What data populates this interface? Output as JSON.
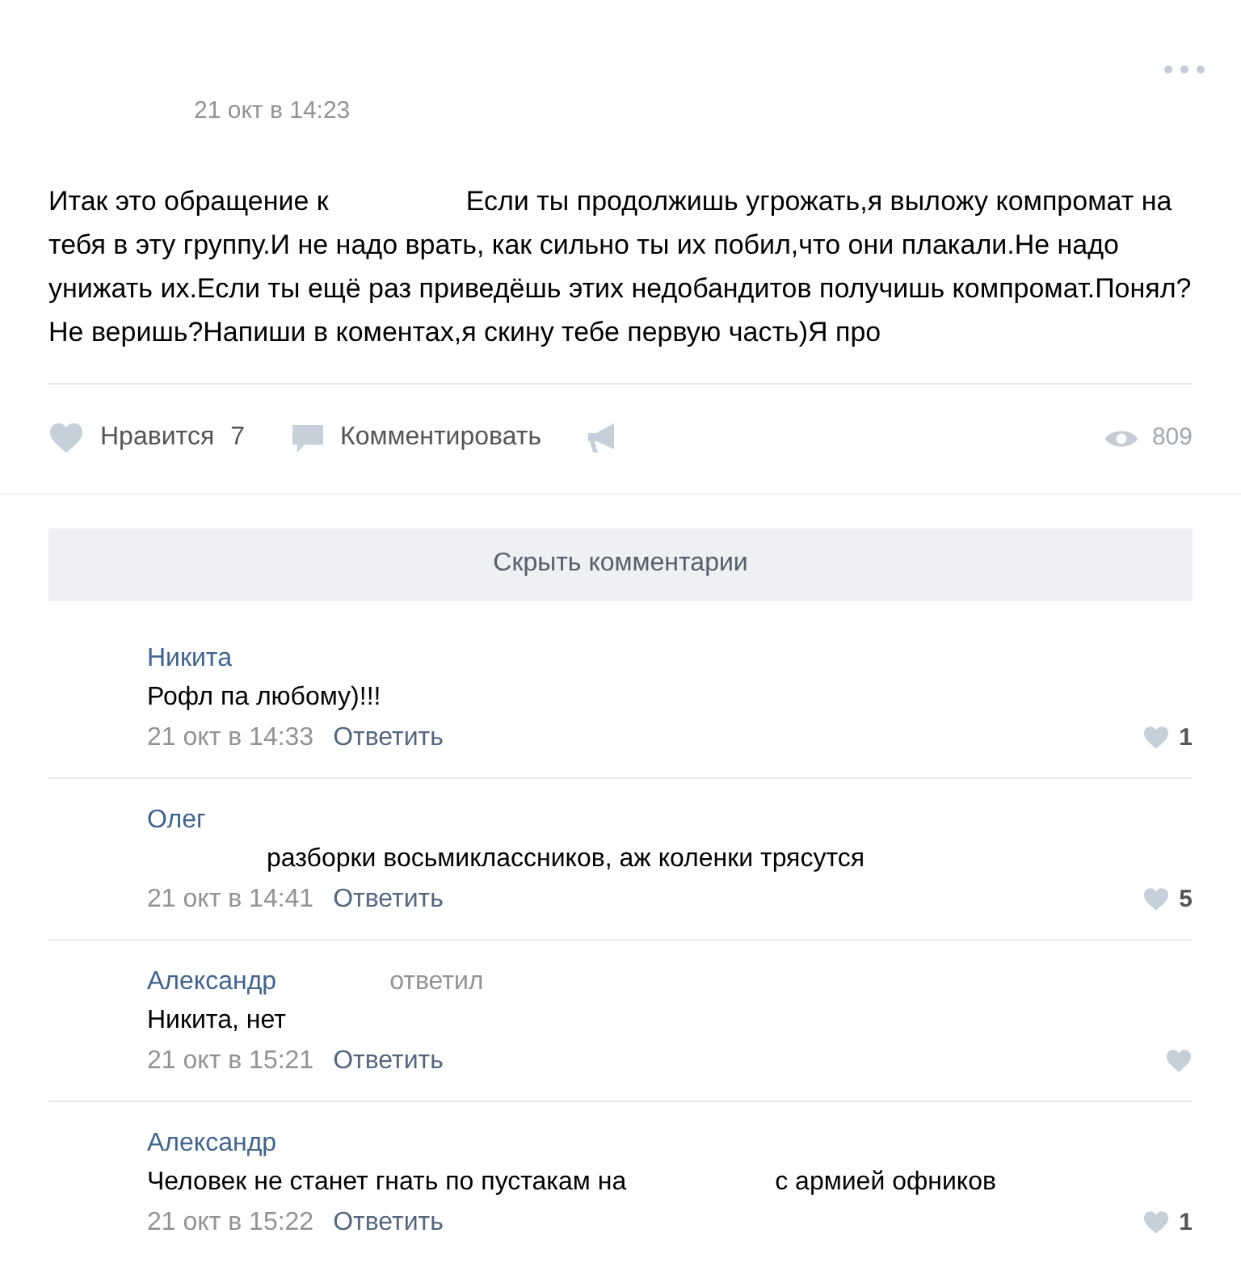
{
  "post": {
    "date": "21 окт в 14:23",
    "text_segments": [
      "Итак это обращение к",
      "Если ты продолжишь угрожать,я выложу компромат на тебя в эту группу.И не надо врать, как сильно ты их побил,что они плакали.Не надо унижать их.Если ты ещё раз приведёшь этих недобандитов получишь компромат.Понял?Не веришь?Напиши в коментах,я скину тебе первую часть)Я про"
    ],
    "like_label": "Нравится",
    "like_count": "7",
    "comment_label": "Комментировать",
    "views": "809"
  },
  "hide_comments": "Скрыть комментарии",
  "comments": [
    {
      "author": "Никита",
      "lead_gap": false,
      "text_segments": [
        "Рофл па любому)!!!"
      ],
      "date": "21 окт в 14:33",
      "reply": "Ответить",
      "likes": "1"
    },
    {
      "author": "Олег",
      "lead_gap": true,
      "text_segments": [
        "разборки восьмиклассников, аж коленки трясутся"
      ],
      "date": "21 окт в 14:41",
      "reply": "Ответить",
      "likes": "5"
    },
    {
      "author": "Александр",
      "note": "ответил",
      "lead_gap": false,
      "text_segments": [
        "Никита, нет"
      ],
      "date": "21 окт в 15:21",
      "reply": "Ответить"
    },
    {
      "author": "Александр",
      "lead_gap": false,
      "text_segments": [
        "Человек не станет гнать по пустакам на",
        "с армией офников"
      ],
      "date": "21 окт в 15:22",
      "reply": "Ответить",
      "likes": "1"
    }
  ]
}
